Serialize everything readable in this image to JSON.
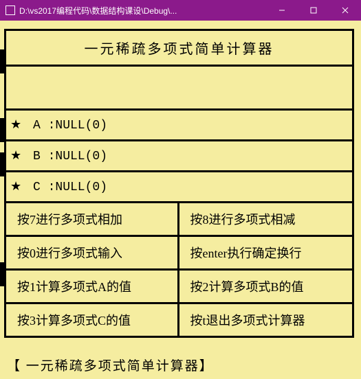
{
  "window": {
    "title": "D:\\vs2017编程代码\\数据结构课设\\Debug\\..."
  },
  "header": "一元稀疏多项式简单计算器",
  "stars": "★",
  "polys": [
    {
      "name": "A",
      "value": "NULL(0)"
    },
    {
      "name": "B",
      "value": "NULL(0)"
    },
    {
      "name": "C",
      "value": "NULL(0)"
    }
  ],
  "menu": [
    {
      "left": "按7进行多项式相加",
      "right": "按8进行多项式相减"
    },
    {
      "left": "按0进行多项式输入",
      "right": "按enter执行确定换行"
    },
    {
      "left": "按1计算多项式A的值",
      "right": "按2计算多项式B的值"
    },
    {
      "left": "按3计算多项式C的值",
      "right": "按t退出多项式计算器"
    }
  ],
  "footer": "【 一元稀疏多项式简单计算器】"
}
